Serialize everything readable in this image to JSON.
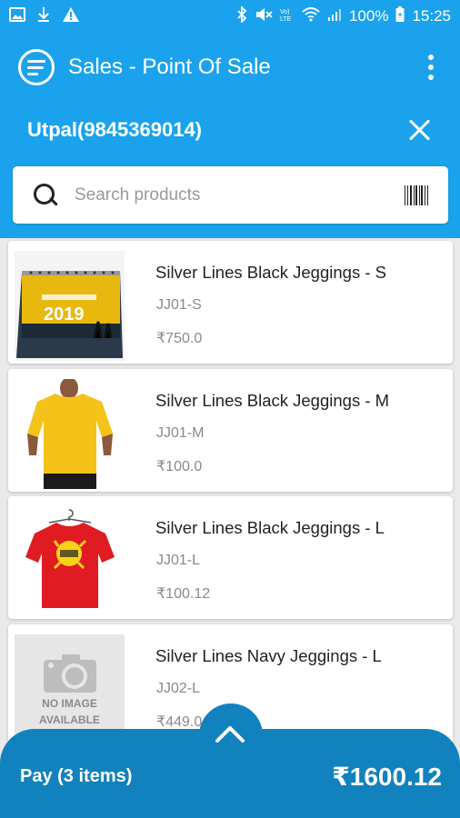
{
  "status_bar": {
    "battery": "100%",
    "time": "15:25"
  },
  "app_bar": {
    "title": "Sales - Point Of Sale"
  },
  "customer": {
    "name": "Utpal(9845369014)"
  },
  "search": {
    "placeholder": "Search products"
  },
  "products": [
    {
      "name": "Silver Lines Black Jeggings - S",
      "sku": "JJ01-S",
      "price": "₹750.0",
      "image": "calendar-2019"
    },
    {
      "name": "Silver Lines Black Jeggings - M",
      "sku": "JJ01-M",
      "price": "₹100.0",
      "image": "yellow-tshirt"
    },
    {
      "name": "Silver Lines Black Jeggings - L",
      "sku": "JJ01-L",
      "price": "₹100.12",
      "image": "red-tshirt"
    },
    {
      "name": "Silver Lines Navy Jeggings - L",
      "sku": "JJ02-L",
      "price": "₹449.0",
      "image": "no-image"
    }
  ],
  "thumb_text": {
    "calendar_year": "2019",
    "no_image_line1": "NO IMAGE",
    "no_image_line2": "AVAILABLE"
  },
  "pay_bar": {
    "label": "Pay (3 items)",
    "total": "₹1600.12"
  },
  "colors": {
    "primary": "#1aa3ec",
    "pay_bar": "#1182bd"
  }
}
